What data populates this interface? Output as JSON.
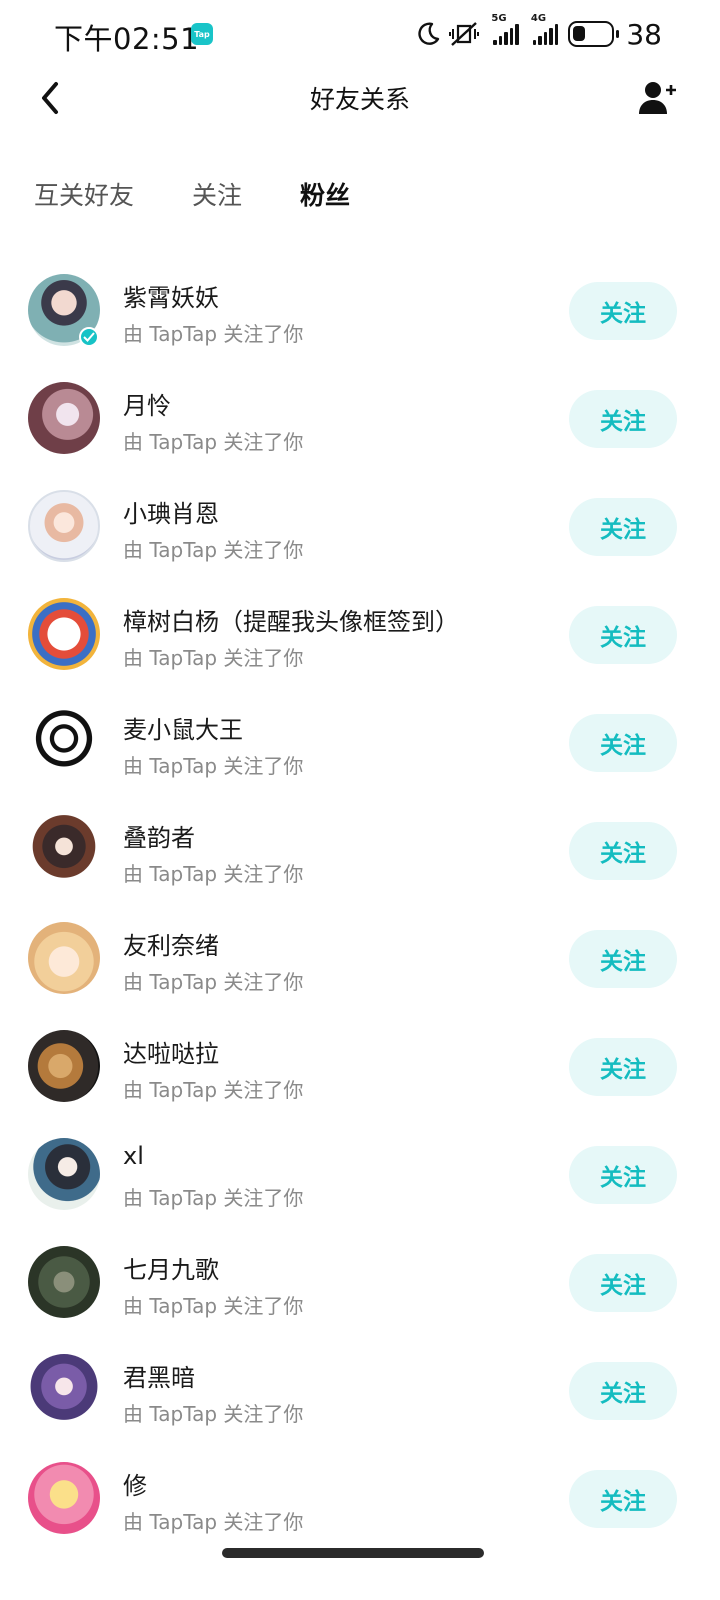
{
  "status_bar": {
    "time": "下午02:51",
    "app_badge": "Tap",
    "network_1": "5G",
    "network_2": "4G",
    "battery": "38"
  },
  "header": {
    "title": "好友关系"
  },
  "tabs": [
    {
      "label": "互关好友",
      "active": false
    },
    {
      "label": "关注",
      "active": false
    },
    {
      "label": "粉丝",
      "active": true
    }
  ],
  "followers": [
    {
      "name": "紫霄妖妖",
      "subtitle": "由 TapTap 关注了你",
      "button": "关注",
      "verified": true
    },
    {
      "name": "月怜",
      "subtitle": "由 TapTap 关注了你",
      "button": "关注"
    },
    {
      "name": "小琠肖恩",
      "subtitle": "由 TapTap 关注了你",
      "button": "关注"
    },
    {
      "name": "樟树白杨（提醒我头像框签到）",
      "subtitle": "由 TapTap 关注了你",
      "button": "关注"
    },
    {
      "name": "麦小鼠大王",
      "subtitle": "由 TapTap 关注了你",
      "button": "关注"
    },
    {
      "name": "叠韵者",
      "subtitle": "由 TapTap 关注了你",
      "button": "关注"
    },
    {
      "name": "友利奈绪",
      "subtitle": "由 TapTap 关注了你",
      "button": "关注"
    },
    {
      "name": "达啦哒拉",
      "subtitle": "由 TapTap 关注了你",
      "button": "关注"
    },
    {
      "name": "xl",
      "subtitle": "由 TapTap 关注了你",
      "button": "关注"
    },
    {
      "name": "七月九歌",
      "subtitle": "由 TapTap 关注了你",
      "button": "关注"
    },
    {
      "name": "君黑暗",
      "subtitle": "由 TapTap 关注了你",
      "button": "关注"
    },
    {
      "name": "修",
      "subtitle": "由 TapTap 关注了你",
      "button": "关注"
    }
  ],
  "colors": {
    "accent": "#17c3c6",
    "button_bg": "#e6f8f8",
    "subtext": "#8a8a8a"
  },
  "icons": {
    "back": "chevron-left-icon",
    "add_friend": "add-user-icon",
    "verified": "verified-badge-icon"
  }
}
